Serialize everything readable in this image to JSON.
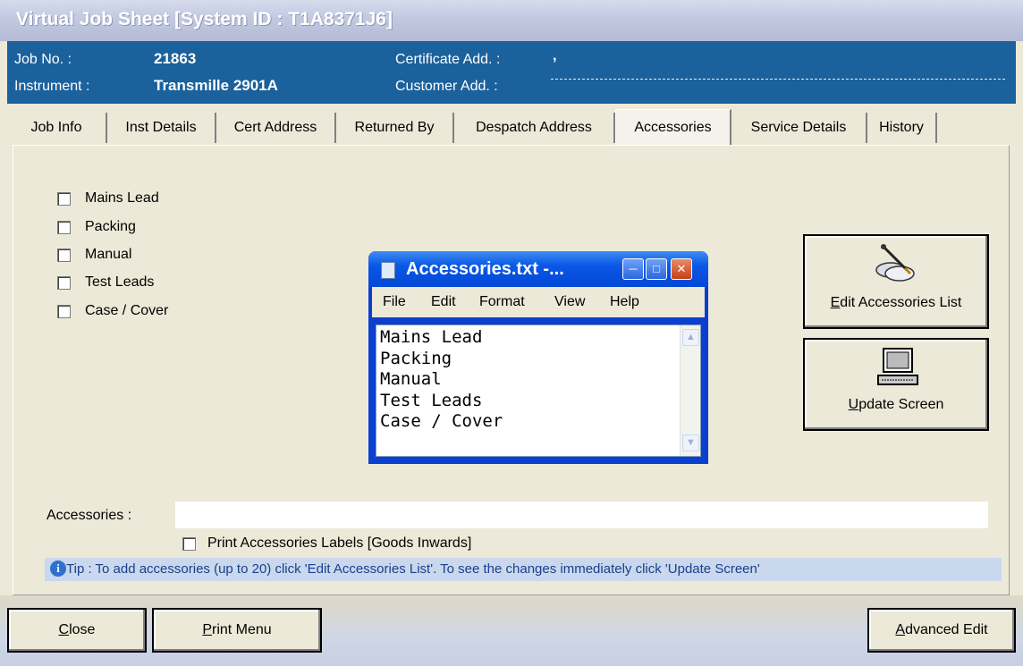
{
  "window": {
    "title": "Virtual Job Sheet [System ID : T1A8371J6]"
  },
  "header": {
    "job_no_label": "Job No. :",
    "job_no": "21863",
    "instrument_label": "Instrument :",
    "instrument": "Transmille 2901A",
    "cert_add_label": "Certificate Add. :",
    "cert_add_value": ",",
    "customer_add_label": "Customer Add. :"
  },
  "tabs": [
    "Job Info",
    "Inst Details",
    "Cert Address",
    "Returned By",
    "Despatch Address",
    "Accessories",
    "Service Details",
    "History"
  ],
  "active_tab": "Accessories",
  "checkboxes": [
    "Mains Lead",
    "Packing",
    "Manual",
    "Test Leads",
    "Case / Cover"
  ],
  "notepad": {
    "title": "Accessories.txt -...",
    "menu": [
      "File",
      "Edit",
      "Format",
      "View",
      "Help"
    ],
    "lines": [
      "Mains Lead",
      "Packing",
      "Manual",
      "Test Leads",
      "Case / Cover"
    ]
  },
  "buttons": {
    "edit_accessories": {
      "mnemonic": "E",
      "rest": "dit Accessories List"
    },
    "update_screen": {
      "mnemonic": "U",
      "rest": "pdate Screen"
    },
    "close": {
      "mnemonic": "C",
      "rest": "lose"
    },
    "print_menu": {
      "mnemonic": "P",
      "rest": "rint Menu"
    },
    "advanced_edit": {
      "mnemonic": "A",
      "rest": "dvanced Edit"
    }
  },
  "accessories_label": "Accessories :",
  "accessories_value": "",
  "print_labels": {
    "pre": "Print Accessories ",
    "mnemonic": "L",
    "post": "abels [Goods Inwards]"
  },
  "tip": "Tip : To add accessories (up to 20) click 'Edit Accessories List'. To see the changes immediately click 'Update Screen'"
}
